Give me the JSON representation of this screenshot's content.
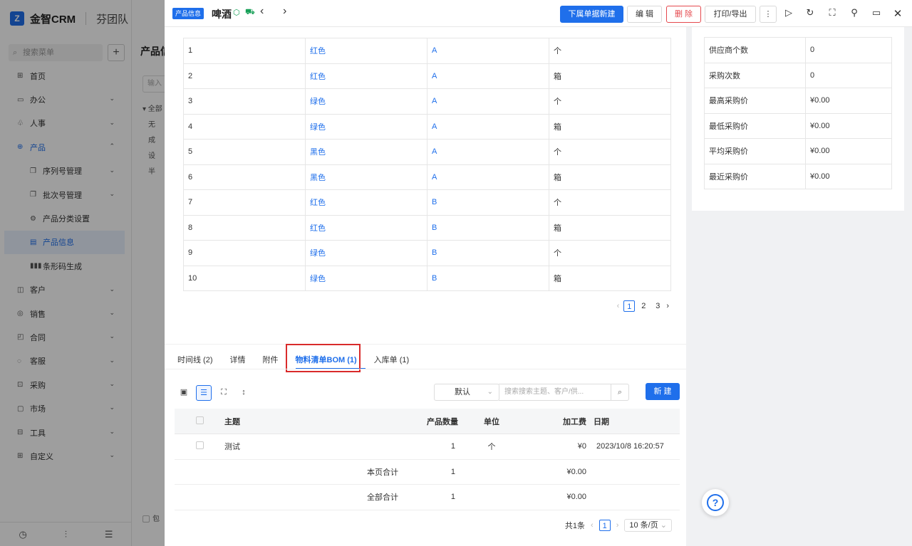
{
  "app": {
    "brand": "金智CRM",
    "team": "芬团队",
    "logo_letter": "Z",
    "search_placeholder": "搜索菜单"
  },
  "sidebar": {
    "items": [
      {
        "label": "首页",
        "icon": "home-icon",
        "glyph": "⊞",
        "level": 0,
        "caret": ""
      },
      {
        "label": "办公",
        "icon": "office-icon",
        "glyph": "▭",
        "level": 0,
        "caret": "⌄"
      },
      {
        "label": "人事",
        "icon": "people-icon",
        "glyph": "♧",
        "level": 0,
        "caret": "⌄"
      },
      {
        "label": "产品",
        "icon": "product-icon",
        "glyph": "⊕",
        "level": 0,
        "caret": "⌃",
        "open": true
      },
      {
        "label": "序列号管理",
        "icon": "copy-icon",
        "glyph": "❐",
        "level": 1,
        "caret": "⌄"
      },
      {
        "label": "批次号管理",
        "icon": "copy-icon",
        "glyph": "❐",
        "level": 1,
        "caret": "⌄"
      },
      {
        "label": "产品分类设置",
        "icon": "settings-icon",
        "glyph": "⚙",
        "level": 1,
        "caret": ""
      },
      {
        "label": "产品信息",
        "icon": "doc-icon",
        "glyph": "▤",
        "level": 1,
        "caret": "",
        "active": true
      },
      {
        "label": "条形码生成",
        "icon": "barcode-icon",
        "glyph": "▮▮▮",
        "level": 1,
        "caret": ""
      },
      {
        "label": "客户",
        "icon": "customer-icon",
        "glyph": "◫",
        "level": 0,
        "caret": "⌄"
      },
      {
        "label": "销售",
        "icon": "sales-icon",
        "glyph": "◎",
        "level": 0,
        "caret": "⌄"
      },
      {
        "label": "合同",
        "icon": "contract-icon",
        "glyph": "◰",
        "level": 0,
        "caret": "⌄"
      },
      {
        "label": "客服",
        "icon": "service-icon",
        "glyph": "◌",
        "level": 0,
        "caret": "⌄"
      },
      {
        "label": "采购",
        "icon": "purchase-icon",
        "glyph": "⊡",
        "level": 0,
        "caret": "⌄"
      },
      {
        "label": "市场",
        "icon": "market-icon",
        "glyph": "▢",
        "level": 0,
        "caret": "⌄"
      },
      {
        "label": "工具",
        "icon": "tool-icon",
        "glyph": "⊟",
        "level": 0,
        "caret": "⌄"
      },
      {
        "label": "自定义",
        "icon": "custom-icon",
        "glyph": "⊞",
        "level": 0,
        "caret": "⌄"
      }
    ],
    "footer_icons": [
      "history-icon",
      "sliders-icon",
      "collapse-icon"
    ]
  },
  "midpanel": {
    "title": "产品信",
    "input_placeholder": "输入",
    "tree": [
      "▾ 全部",
      "无",
      "成",
      "设",
      "半"
    ],
    "check_label": "包"
  },
  "header": {
    "tag": "产品信息",
    "title": "啤酒",
    "buttons": {
      "sub_create": "下属单据新建",
      "edit": "编 辑",
      "delete": "删 除",
      "print": "打印/导出",
      "more": "⋮"
    }
  },
  "variants": {
    "rows": [
      [
        "1",
        "红色",
        "A",
        "个"
      ],
      [
        "2",
        "红色",
        "A",
        "箱"
      ],
      [
        "3",
        "绿色",
        "A",
        "个"
      ],
      [
        "4",
        "绿色",
        "A",
        "箱"
      ],
      [
        "5",
        "黑色",
        "A",
        "个"
      ],
      [
        "6",
        "黑色",
        "A",
        "箱"
      ],
      [
        "7",
        "红色",
        "B",
        "个"
      ],
      [
        "8",
        "红色",
        "B",
        "箱"
      ],
      [
        "9",
        "绿色",
        "B",
        "个"
      ],
      [
        "10",
        "绿色",
        "B",
        "箱"
      ]
    ],
    "pager": {
      "pages": [
        "1",
        "2",
        "3"
      ],
      "current": "1"
    }
  },
  "stats": [
    [
      "供应商个数",
      "0"
    ],
    [
      "采购次数",
      "0"
    ],
    [
      "最高采购价",
      "¥0.00"
    ],
    [
      "最低采购价",
      "¥0.00"
    ],
    [
      "平均采购价",
      "¥0.00"
    ],
    [
      "最近采购价",
      "¥0.00"
    ]
  ],
  "tabs": [
    {
      "label": "时间线 (2)",
      "active": false
    },
    {
      "label": "详情",
      "active": false
    },
    {
      "label": "附件",
      "active": false
    },
    {
      "label": "物料清单BOM (1)",
      "active": true
    },
    {
      "label": "入库单 (1)",
      "active": false
    }
  ],
  "bom": {
    "sort_default": "默认",
    "search_placeholder": "搜索搜索主题、客户/供...",
    "new_label": "新 建",
    "columns": {
      "subject": "主题",
      "qty": "产品数量",
      "unit": "单位",
      "fee": "加工费",
      "date": "日期"
    },
    "rows": [
      {
        "subject": "测试",
        "qty": "1",
        "unit": "个",
        "fee": "¥0",
        "date": "2023/10/8 16:20:57"
      }
    ],
    "page_total": {
      "label": "本页合计",
      "qty": "1",
      "fee": "¥0.00"
    },
    "all_total": {
      "label": "全部合计",
      "qty": "1",
      "fee": "¥0.00"
    },
    "pager": {
      "total": "共1条",
      "current": "1",
      "page_size": "10 条/页"
    }
  },
  "help": "?"
}
